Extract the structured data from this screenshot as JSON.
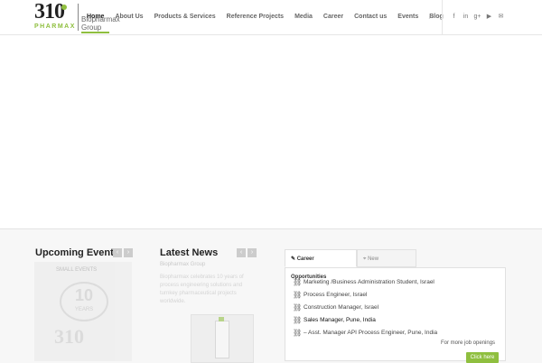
{
  "header": {
    "logo_number": "310",
    "logo_sub": "PHARMAX",
    "group_label": "Biopharmax Group",
    "nav": [
      {
        "label": "Home",
        "active": true
      },
      {
        "label": "About Us"
      },
      {
        "label": "Products & Services"
      },
      {
        "label": "Reference Projects"
      },
      {
        "label": "Media"
      },
      {
        "label": "Career"
      },
      {
        "label": "Contact us"
      },
      {
        "label": "Events"
      },
      {
        "label": "Blog"
      }
    ],
    "search_icon": "⌕",
    "social": [
      {
        "name": "facebook-icon",
        "glyph": "f"
      },
      {
        "name": "linkedin-icon",
        "glyph": "in"
      },
      {
        "name": "googleplus-icon",
        "glyph": "g+"
      },
      {
        "name": "youtube-icon",
        "glyph": "▶"
      },
      {
        "name": "mail-icon",
        "glyph": "✉"
      }
    ]
  },
  "events": {
    "title": "Upcoming Events",
    "prev": "‹",
    "next": "›",
    "image_caption": "SMALL EVENTS",
    "badge_big": "10",
    "badge_small": "YEARS",
    "badge_brand": "310"
  },
  "news": {
    "title": "Latest News",
    "prev": "‹",
    "next": "›",
    "meta": "Biopharmax Group",
    "excerpt": "Biopharmax celebrates 10 years of process engineering solutions and turnkey pharmaceutical projects worldwide."
  },
  "career": {
    "tabs": [
      {
        "label": "Career Opportunities",
        "icon": "✎",
        "active": true
      },
      {
        "label": "New Technologies",
        "icon": "⌖"
      }
    ],
    "link_icon": "🔗",
    "jobs": [
      "Marketing /Business Administration Student, Israel",
      "Process Engineer, Israel",
      "Construction Manager, Israel",
      "Sales Manager, Pune, India",
      "– Asst.  Manager API Process Engineer, Pune, India"
    ],
    "more_label": "For more job openings",
    "button_label": "Click here"
  },
  "colors": {
    "accent": "#8fbf3f"
  }
}
